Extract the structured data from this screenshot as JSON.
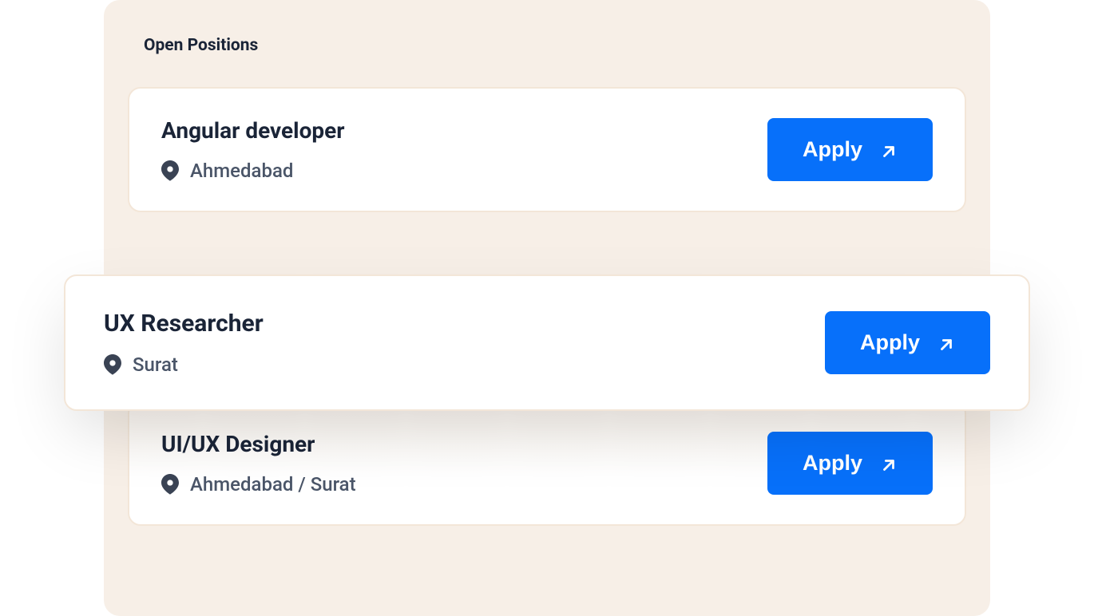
{
  "section": {
    "title": "Open Positions"
  },
  "positions": [
    {
      "title": "Angular developer",
      "location": "Ahmedabad",
      "apply_label": "Apply"
    },
    {
      "title": "UX Researcher",
      "location": "Surat",
      "apply_label": "Apply"
    },
    {
      "title": "UI/UX Designer",
      "location": "Ahmedabad / Surat",
      "apply_label": "Apply"
    }
  ]
}
